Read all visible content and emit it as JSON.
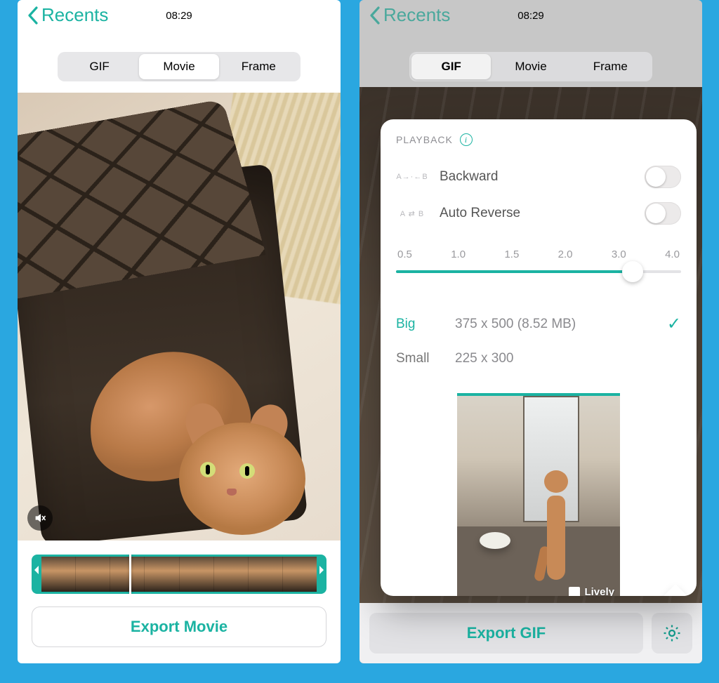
{
  "left": {
    "back_label": "Recents",
    "time": "08:29",
    "tabs": {
      "gif": "GIF",
      "movie": "Movie",
      "frame": "Frame",
      "active": "Movie"
    },
    "mute_icon": "speaker-muted-icon",
    "export_label": "Export Movie"
  },
  "right": {
    "back_label": "Recents",
    "time": "08:29",
    "tabs": {
      "gif": "GIF",
      "movie": "Movie",
      "frame": "Frame",
      "active": "GIF"
    },
    "export_label": "Export GIF",
    "settings": {
      "section_title": "PLAYBACK",
      "backward_label": "Backward",
      "autoreverse_label": "Auto Reverse",
      "backward_on": false,
      "autoreverse_on": false,
      "speed_ticks": [
        "0.5",
        "1.0",
        "1.5",
        "2.0",
        "3.0",
        "4.0"
      ],
      "speed_value": 3.0,
      "sizes": {
        "big": {
          "name": "Big",
          "dims": "375 x 500 (8.52 MB)",
          "selected": true
        },
        "small": {
          "name": "Small",
          "dims": "225 x 300",
          "selected": false
        }
      },
      "watermark": "Lively"
    }
  }
}
